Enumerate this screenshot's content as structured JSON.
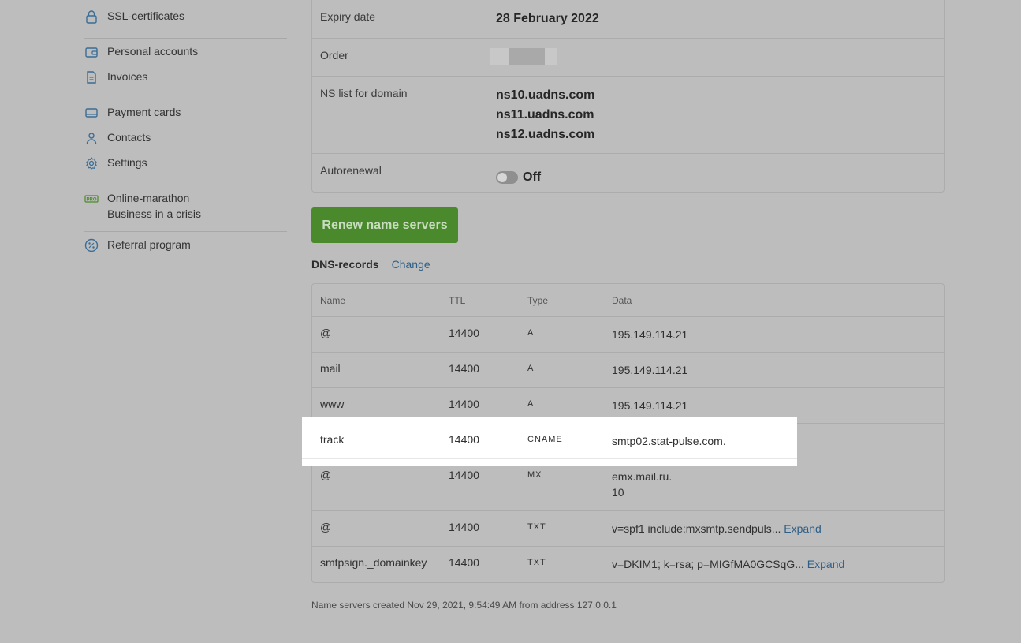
{
  "sidebar": {
    "groups": [
      [
        {
          "label": "SSL-certificates",
          "icon": "lock-icon"
        }
      ],
      [
        {
          "label": "Personal accounts",
          "icon": "wallet-icon"
        },
        {
          "label": "Invoices",
          "icon": "document-icon"
        }
      ],
      [
        {
          "label": "Payment cards",
          "icon": "card-icon"
        },
        {
          "label": "Contacts",
          "icon": "user-icon"
        },
        {
          "label": "Settings",
          "icon": "gear-icon"
        }
      ],
      [
        {
          "label": "Online-marathon",
          "label2": "Business in a crisis",
          "icon": "pro-badge-icon"
        }
      ],
      [
        {
          "label": "Referral program",
          "icon": "percent-icon"
        }
      ]
    ]
  },
  "domain_info": {
    "expiry_label": "Expiry date",
    "expiry_value": "28 February 2022",
    "order_label": "Order",
    "ns_label": "NS list for domain",
    "ns": [
      "ns10.uadns.com",
      "ns11.uadns.com",
      "ns12.uadns.com"
    ],
    "autorenewal_label": "Autorenewal",
    "autorenewal_value": "Off"
  },
  "renew_button": "Renew name servers",
  "dns": {
    "title": "DNS-records",
    "change_label": "Change",
    "headers": {
      "name": "Name",
      "ttl": "TTL",
      "type": "Type",
      "data": "Data"
    },
    "records": [
      {
        "name": "@",
        "ttl": "14400",
        "type": "A",
        "data": "195.149.114.21"
      },
      {
        "name": "mail",
        "ttl": "14400",
        "type": "A",
        "data": "195.149.114.21"
      },
      {
        "name": "www",
        "ttl": "14400",
        "type": "A",
        "data": "195.149.114.21"
      },
      {
        "name": "track",
        "ttl": "14400",
        "type": "CNAME",
        "data": "smtp02.stat-pulse.com."
      },
      {
        "name": "@",
        "ttl": "14400",
        "type": "MX",
        "data": "emx.mail.ru.",
        "data2": "10"
      },
      {
        "name": "@",
        "ttl": "14400",
        "type": "TXT",
        "data": "v=spf1 include:mxsmtp.sendpuls...",
        "expand": "Expand"
      },
      {
        "name": "smtpsign._domainkey",
        "ttl": "14400",
        "type": "TXT",
        "data": "v=DKIM1; k=rsa; p=MIGfMA0GCSqG...",
        "expand": "Expand"
      }
    ]
  },
  "footer_note": "Name servers created Nov 29, 2021, 9:54:49 AM from address 127.0.0.1",
  "colors": {
    "accent_green": "#4b8a2c",
    "link_blue": "#2e5e86",
    "icon_blue": "#3a6d96"
  }
}
